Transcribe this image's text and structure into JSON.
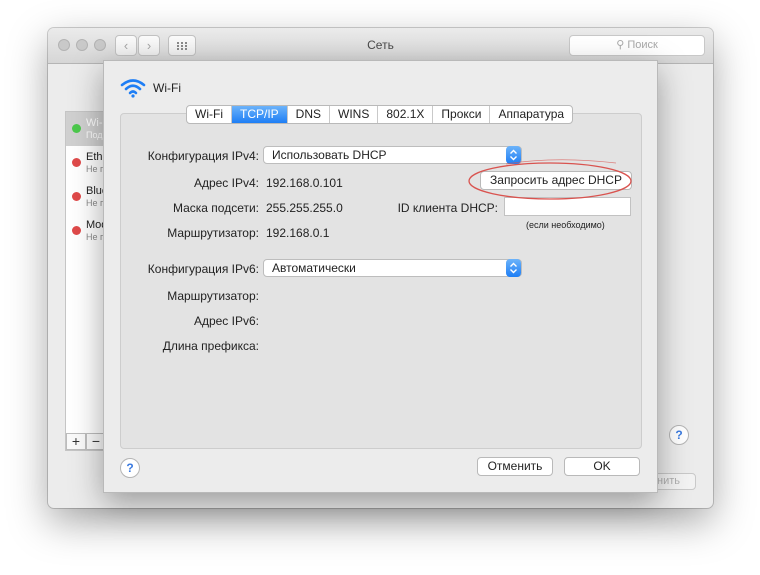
{
  "window": {
    "title": "Сеть",
    "search_placeholder": "Поиск",
    "nav_back": "‹",
    "nav_forward": "›",
    "add": "+",
    "remove": "−",
    "help": "?",
    "apply_fragment": "нить"
  },
  "sidebar": {
    "items": [
      {
        "name": "Wi-",
        "sub": "Под",
        "status_color": "#4cc94c",
        "selected": true
      },
      {
        "name": "Ethe",
        "sub": "Не п",
        "status_color": "#e04a4a",
        "selected": false
      },
      {
        "name": "Blue",
        "sub": "Не п",
        "status_color": "#e04a4a",
        "selected": false
      },
      {
        "name": "Mod",
        "sub": "Не п",
        "status_color": "#e04a4a",
        "selected": false
      }
    ]
  },
  "sheet": {
    "title": "Wi-Fi",
    "tabs": [
      "Wi-Fi",
      "TCP/IP",
      "DNS",
      "WINS",
      "802.1X",
      "Прокси",
      "Аппаратура"
    ],
    "active_tab": "TCP/IP",
    "ipv4": {
      "config_label": "Конфигурация IPv4:",
      "config_value": "Использовать DHCP",
      "address_label": "Адрес IPv4:",
      "address_value": "192.168.0.101",
      "mask_label": "Маска подсети:",
      "mask_value": "255.255.255.0",
      "router_label": "Маршрутизатор:",
      "router_value": "192.168.0.1",
      "renew_button": "Запросить адрес DHCP",
      "client_id_label": "ID клиента DHCP:",
      "client_id_value": "",
      "client_id_hint": "(если необходимо)"
    },
    "ipv6": {
      "config_label": "Конфигурация IPv6:",
      "config_value": "Автоматически",
      "router_label": "Маршрутизатор:",
      "address_label": "Адрес IPv6:",
      "prefix_label": "Длина префикса:"
    },
    "cancel_button": "Отменить",
    "ok_button": "OK",
    "help": "?"
  },
  "colors": {
    "accent": "#1e7ef5",
    "annotation": "#d9534f"
  }
}
